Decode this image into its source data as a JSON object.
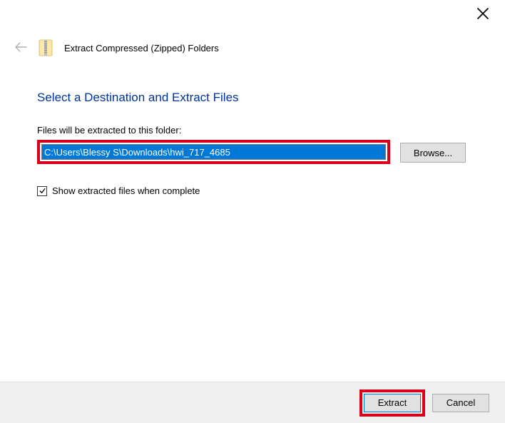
{
  "window": {
    "wizard_title": "Extract Compressed (Zipped) Folders"
  },
  "main": {
    "heading": "Select a Destination and Extract Files",
    "path_label": "Files will be extracted to this folder:",
    "path_value": "C:\\Users\\Blessy S\\Downloads\\hwi_717_4685",
    "browse_label": "Browse...",
    "show_extracted_label": "Show extracted files when complete"
  },
  "footer": {
    "extract_label": "Extract",
    "cancel_label": "Cancel"
  }
}
